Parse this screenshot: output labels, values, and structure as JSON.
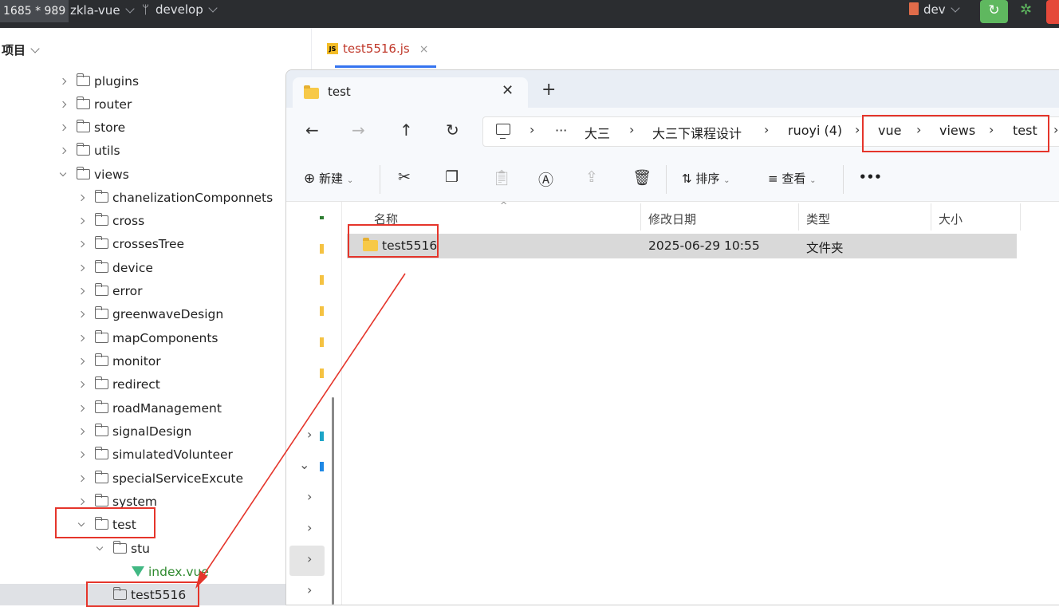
{
  "overlay": {
    "dimensions_label": "1685 * 989"
  },
  "ide": {
    "project_name": "zkla-vue",
    "branch": "develop",
    "current_branch": "dev",
    "panel_title": "项目",
    "tab": {
      "icon_label": "JS",
      "file": "test5516.js",
      "close": "×"
    },
    "tree": [
      {
        "name": "plugins",
        "expanded": false
      },
      {
        "name": "router",
        "expanded": false
      },
      {
        "name": "store",
        "expanded": false
      },
      {
        "name": "utils",
        "expanded": false
      },
      {
        "name": "views",
        "expanded": true
      },
      {
        "name": "chanelizationComponnets",
        "expanded": false
      },
      {
        "name": "cross",
        "expanded": false
      },
      {
        "name": "crossesTree",
        "expanded": false
      },
      {
        "name": "device",
        "expanded": false
      },
      {
        "name": "error",
        "expanded": false
      },
      {
        "name": "greenwaveDesign",
        "expanded": false
      },
      {
        "name": "mapComponents",
        "expanded": false
      },
      {
        "name": "monitor",
        "expanded": false
      },
      {
        "name": "redirect",
        "expanded": false
      },
      {
        "name": "roadManagement",
        "expanded": false
      },
      {
        "name": "signalDesign",
        "expanded": false
      },
      {
        "name": "simulatedVolunteer",
        "expanded": false
      },
      {
        "name": "specialServiceExcute",
        "expanded": false
      },
      {
        "name": "system",
        "expanded": false
      },
      {
        "name": "test",
        "expanded": true
      },
      {
        "name": "stu",
        "expanded": true
      },
      {
        "name": "index.vue",
        "type": "vue-file"
      },
      {
        "name": "test5516",
        "selected": true
      }
    ]
  },
  "explorer": {
    "tab_title": "test",
    "tab_close": "✕",
    "new_tab": "+",
    "breadcrumb": [
      "大三",
      "大三下课程设计",
      "ruoyi (4)",
      "vue",
      "views",
      "test"
    ],
    "more": "···",
    "commands": {
      "new": "新建",
      "sort": "排序",
      "view": "查看",
      "more": "•••"
    },
    "columns": {
      "name": "名称",
      "modified": "修改日期",
      "type": "类型",
      "size": "大小"
    },
    "files": [
      {
        "name": "test5516",
        "modified": "2025-06-29 10:55",
        "type": "文件夹",
        "size": ""
      }
    ]
  },
  "annotation_color": "#e5352b"
}
